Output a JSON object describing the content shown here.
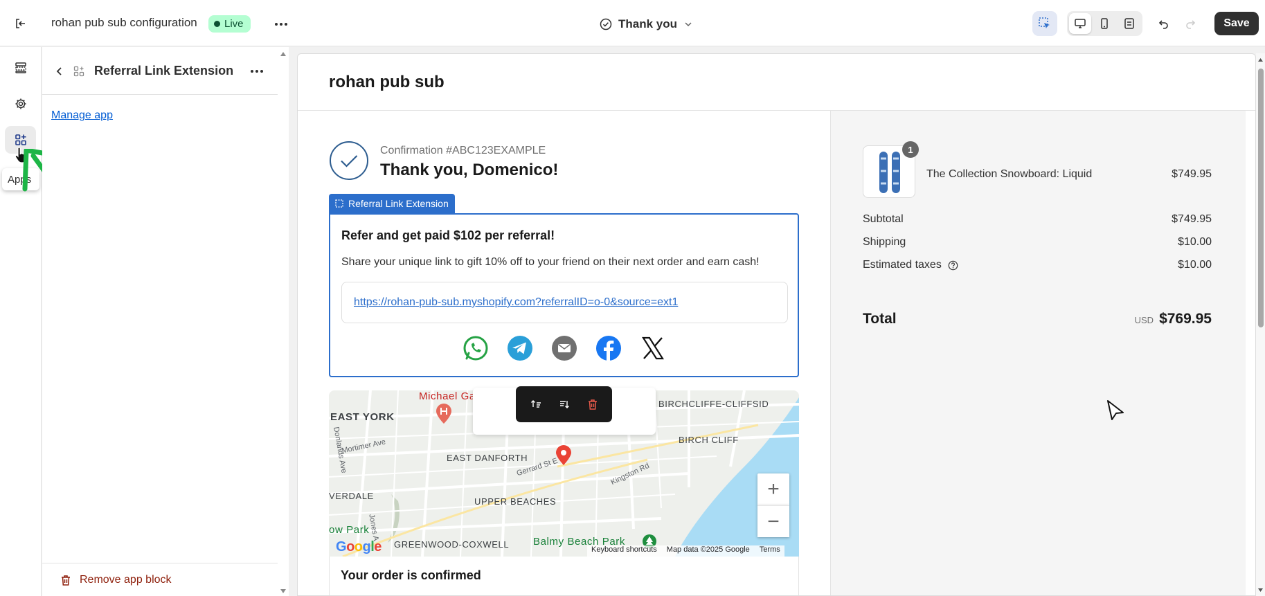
{
  "topbar": {
    "store_name": "rohan pub sub configuration",
    "status_badge": "Live",
    "page_selector": "Thank you",
    "save_label": "Save"
  },
  "sidebar": {
    "tooltip": "Apps"
  },
  "panel": {
    "title": "Referral Link Extension",
    "manage_link": "Manage app",
    "remove_label": "Remove app block"
  },
  "preview": {
    "shop_name": "rohan pub sub",
    "confirmation": "Confirmation #ABC123EXAMPLE",
    "thank_you": "Thank you, Domenico!",
    "extension_tag": "Referral Link Extension",
    "referral": {
      "title": "Refer and get paid $102 per referral!",
      "description": "Share your unique link to gift 10% off to your friend on their next order and earn cash!",
      "link": "https://rohan-pub-sub.myshopify.com?referralID=o-0&source=ext1",
      "share_icons": [
        "whatsapp-icon",
        "telegram-icon",
        "email-icon",
        "facebook-icon",
        "x-icon"
      ]
    },
    "map": {
      "labels": {
        "michael": "Michael Ga",
        "east_york": "EAST YORK",
        "birchcliffe_cliffside": "BIRCHCLIFFE-CLIFFSID",
        "birch_cliff": "BIRCH CLIFF",
        "mortimer": "Mortimer Ave",
        "east_danforth": "EAST DANFORTH",
        "gerrard": "Gerrard St E",
        "kingston": "Kingston Rd",
        "upper_beaches": "UPPER BEACHES",
        "verdale": "VERDALE",
        "ow_park": "ow Park",
        "greenwood": "GREENWOOD-COXWELL",
        "balmy": "Balmy Beach Park",
        "donlands": "Donlands Ave",
        "jones": "Jones A"
      },
      "google": "Google",
      "footer": [
        "Keyboard shortcuts",
        "Map data ©2025 Google",
        "Terms"
      ],
      "zoom_in": "+",
      "zoom_out": "−"
    },
    "order_confirmed": "Your order is confirmed"
  },
  "summary": {
    "product": {
      "name": "The Collection Snowboard: Liquid",
      "price": "$749.95",
      "quantity": "1"
    },
    "rows": [
      {
        "label": "Subtotal",
        "value": "$749.95"
      },
      {
        "label": "Shipping",
        "value": "$10.00"
      },
      {
        "label": "Estimated taxes",
        "value": "$10.00"
      }
    ],
    "total_label": "Total",
    "currency": "USD",
    "total": "$769.95"
  },
  "colors": {
    "accent": "#2c6ecb",
    "live": "#b4fed2",
    "arrow": "#1db546",
    "danger": "#8e1f0b"
  }
}
